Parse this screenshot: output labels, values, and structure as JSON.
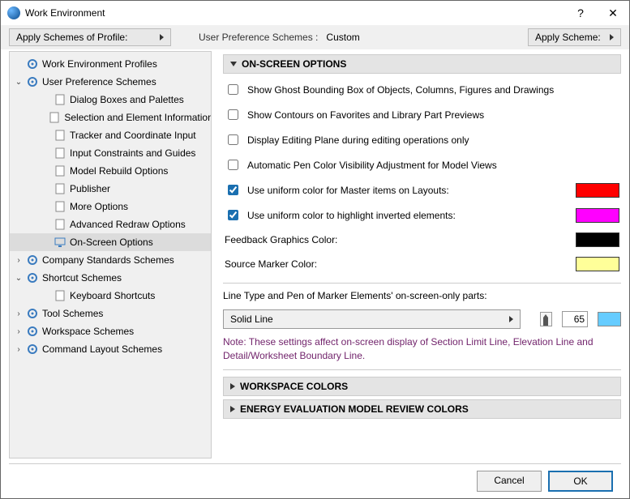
{
  "window": {
    "title": "Work Environment"
  },
  "toolbar": {
    "applyProfile": "Apply Schemes of Profile:",
    "schemesLabel": "User Preference Schemes :",
    "schemesValue": "Custom",
    "applyScheme": "Apply Scheme:"
  },
  "tree": [
    {
      "label": "Work Environment Profiles",
      "indent": 0,
      "caret": "none"
    },
    {
      "label": "User Preference Schemes",
      "indent": 0,
      "caret": "open"
    },
    {
      "label": "Dialog Boxes and Palettes",
      "indent": 2,
      "caret": "none"
    },
    {
      "label": "Selection and Element Information",
      "indent": 2,
      "caret": "none"
    },
    {
      "label": "Tracker and Coordinate Input",
      "indent": 2,
      "caret": "none"
    },
    {
      "label": "Input Constraints and Guides",
      "indent": 2,
      "caret": "none"
    },
    {
      "label": "Model Rebuild Options",
      "indent": 2,
      "caret": "none"
    },
    {
      "label": "Publisher",
      "indent": 2,
      "caret": "none"
    },
    {
      "label": "More Options",
      "indent": 2,
      "caret": "none"
    },
    {
      "label": "Advanced Redraw Options",
      "indent": 2,
      "caret": "none"
    },
    {
      "label": "On-Screen Options",
      "indent": 2,
      "caret": "none",
      "selected": true
    },
    {
      "label": "Company Standards Schemes",
      "indent": 0,
      "caret": "closed"
    },
    {
      "label": "Shortcut Schemes",
      "indent": 0,
      "caret": "open"
    },
    {
      "label": "Keyboard Shortcuts",
      "indent": 2,
      "caret": "none"
    },
    {
      "label": "Tool Schemes",
      "indent": 0,
      "caret": "closed"
    },
    {
      "label": "Workspace Schemes",
      "indent": 0,
      "caret": "closed"
    },
    {
      "label": "Command Layout Schemes",
      "indent": 0,
      "caret": "closed"
    }
  ],
  "sections": {
    "onScreen": "ON-SCREEN OPTIONS",
    "workspace": "WORKSPACE COLORS",
    "energy": "ENERGY EVALUATION MODEL REVIEW COLORS"
  },
  "options": {
    "ghost": "Show Ghost Bounding Box of Objects, Columns, Figures and Drawings",
    "contours": "Show Contours on Favorites and Library Part Previews",
    "editPlane": "Display Editing Plane during editing operations only",
    "autoPen": "Automatic Pen Color Visibility Adjustment for Model Views",
    "uniformMaster": "Use uniform color for Master items on Layouts:",
    "uniformInverted": "Use uniform color to highlight inverted elements:",
    "feedback": "Feedback Graphics Color:",
    "sourceMarker": "Source Marker Color:"
  },
  "colors": {
    "master": "#ff0000",
    "inverted": "#ff00ff",
    "feedback": "#000000",
    "sourceMarker": "#ffff99"
  },
  "linePen": {
    "heading": "Line Type and Pen of Marker Elements' on-screen-only parts:",
    "lineType": "Solid Line",
    "penValue": "65",
    "note": "Note: These settings affect on-screen display of Section Limit Line, Elevation Line and Detail/Worksheet Boundary Line."
  },
  "buttons": {
    "cancel": "Cancel",
    "ok": "OK"
  }
}
